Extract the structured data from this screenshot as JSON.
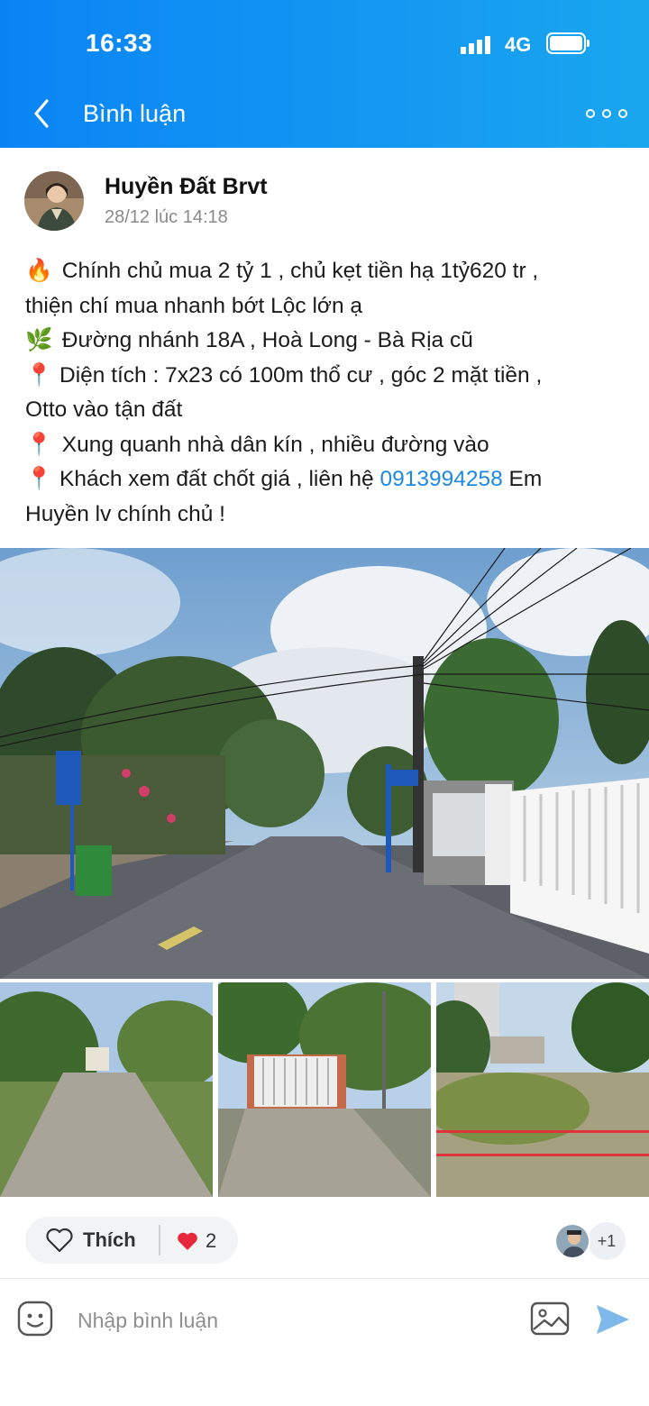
{
  "status_bar": {
    "time": "16:33",
    "network": "4G",
    "battery_level": 0.9
  },
  "header": {
    "title": "Bình luận",
    "back_icon": "chevron-left-icon",
    "more_icon": "more-dots-icon",
    "color": "#0a84f5"
  },
  "post": {
    "author": "Huyền Đất Brvt",
    "timestamp": "28/12 lúc 14:18",
    "lines": [
      {
        "emoji": "🔥",
        "text": " Chính chủ mua 2 tỷ 1 , chủ kẹt tiền hạ 1tỷ620 tr ,"
      },
      {
        "emoji": "",
        "text": "thiện chí mua nhanh bớt Lộc lớn ạ"
      },
      {
        "emoji": "🌿",
        "text": " Đường nhánh 18A , Hoà Long - Bà Rịa cũ"
      },
      {
        "emoji": "📍",
        "text": "Diện tích : 7x23 có 100m thổ cư , góc 2 mặt tiền ,"
      },
      {
        "emoji": "",
        "text": "Otto vào tận đất"
      },
      {
        "emoji": "📍",
        "text": " Xung quanh nhà dân kín , nhiều đường vào"
      },
      {
        "emoji": "📍",
        "text": "Khách xem đất chốt giá , liên hệ ",
        "phone": "0913994258",
        "after": " Em"
      },
      {
        "emoji": "",
        "text": "Huyền lv chính chủ !"
      }
    ],
    "link_color": "#1e88e5"
  },
  "reactions": {
    "like_label": "Thích",
    "heart_count": "2",
    "reactor_more": "+1"
  },
  "composer": {
    "placeholder": "Nhập bình luận",
    "send_color": "#7fb8ea"
  }
}
